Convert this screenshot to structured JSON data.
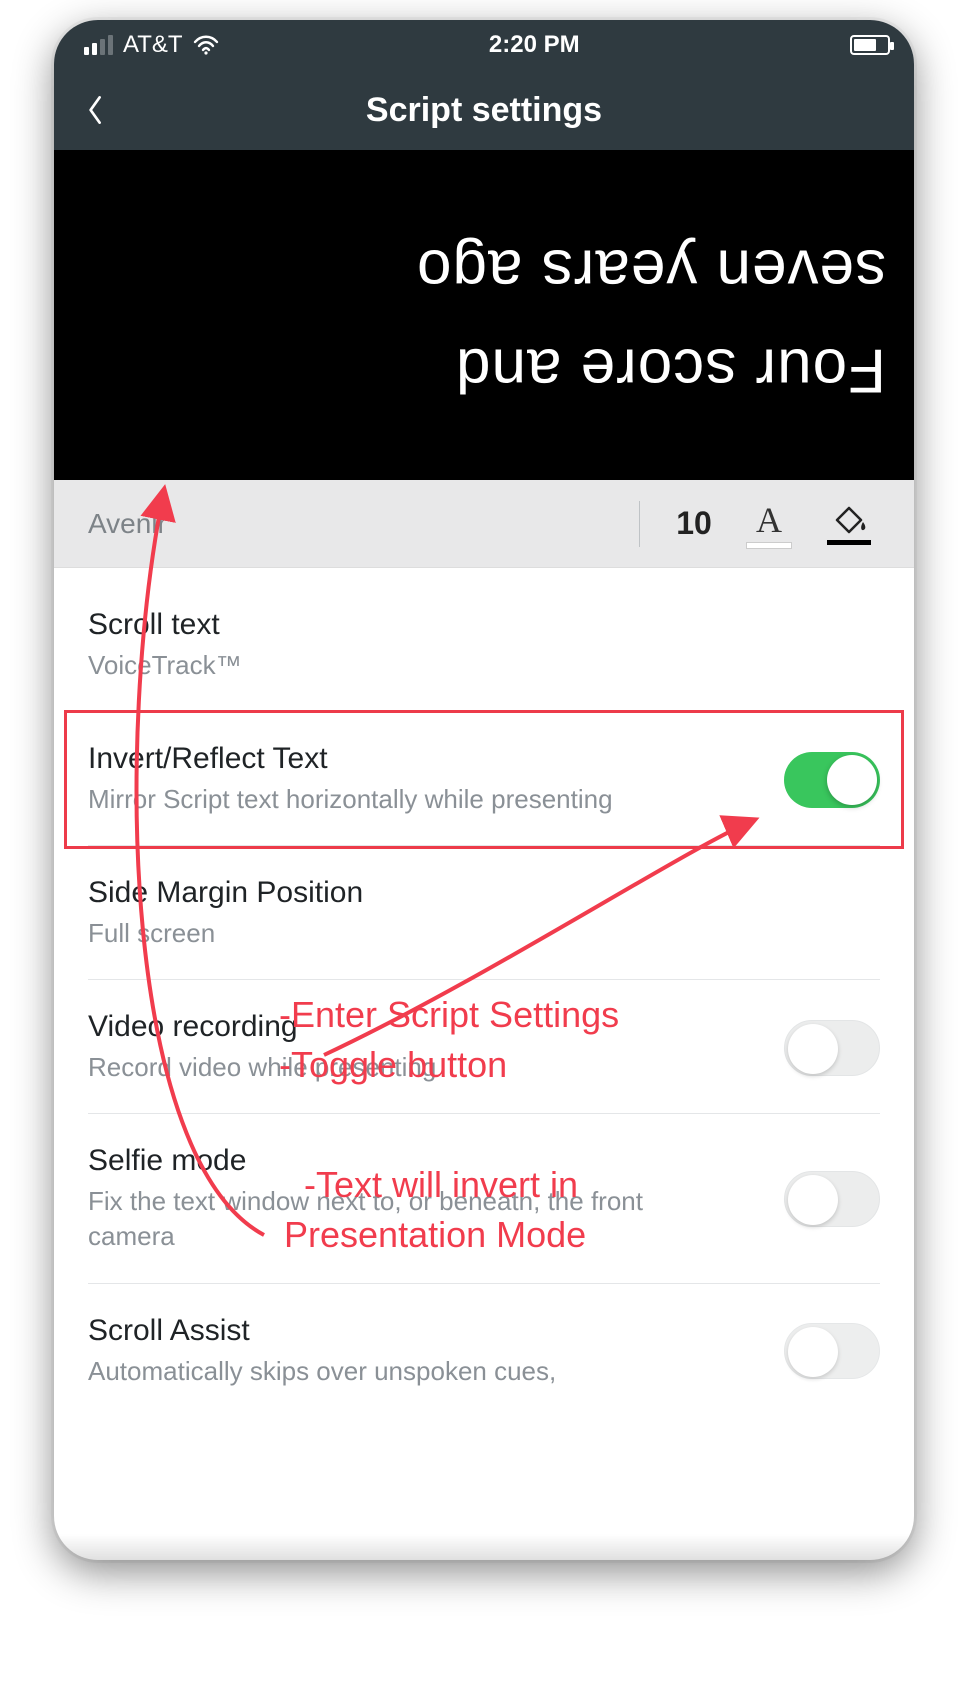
{
  "statusbar": {
    "carrier": "AT&T",
    "time": "2:20 PM"
  },
  "nav": {
    "title": "Script settings"
  },
  "preview": {
    "text": "Four score and\nseven years ago"
  },
  "fontbar": {
    "fontName": "Avenir",
    "fontSize": "10"
  },
  "rows": {
    "scroll": {
      "title": "Scroll text",
      "sub": "VoiceTrack™"
    },
    "invert": {
      "title": "Invert/Reflect Text",
      "sub": "Mirror Script text horizontally while presenting",
      "on": true
    },
    "margin": {
      "title": "Side Margin Position",
      "sub": "Full screen"
    },
    "video": {
      "title": "Video recording",
      "sub": "Record video while presenting",
      "on": false
    },
    "selfie": {
      "title": "Selfie mode",
      "sub": "Fix the text window next to, or beneath, the front camera",
      "on": false
    },
    "assist": {
      "title": "Scroll Assist",
      "sub": "Automatically skips over unspoken cues,"
    }
  },
  "annotations": {
    "line1": "-Enter Script Settings",
    "line2": "-Toggle button",
    "line3a": "-Text will invert in",
    "line3b": "Presentation Mode"
  }
}
